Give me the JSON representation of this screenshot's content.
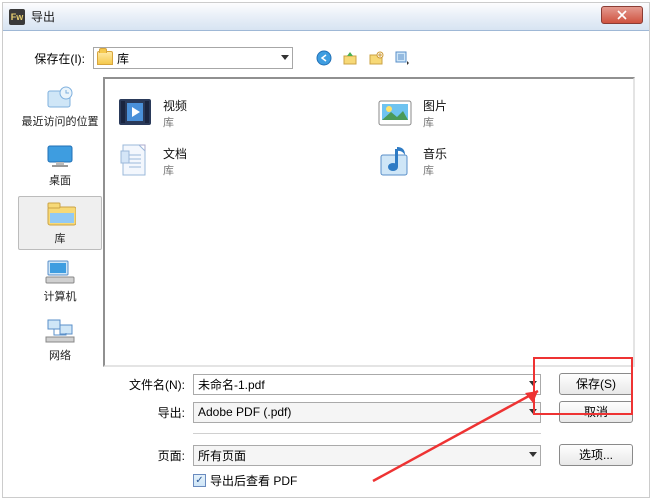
{
  "window": {
    "title": "导出"
  },
  "save_in": {
    "label": "保存在(I):",
    "value": "库"
  },
  "places": {
    "recent": "最近访问的位置",
    "desktop": "桌面",
    "library": "库",
    "computer": "计算机",
    "network": "网络"
  },
  "libraries": {
    "video": {
      "name": "视频",
      "type": "库"
    },
    "pictures": {
      "name": "图片",
      "type": "库"
    },
    "documents": {
      "name": "文档",
      "type": "库"
    },
    "music": {
      "name": "音乐",
      "type": "库"
    }
  },
  "filename": {
    "label": "文件名(N):",
    "value": "未命名-1.pdf"
  },
  "export": {
    "label": "导出:",
    "value": "Adobe PDF (.pdf)"
  },
  "pages": {
    "label": "页面:",
    "value": "所有页面"
  },
  "checkbox": {
    "label": "导出后查看 PDF"
  },
  "buttons": {
    "save": "保存(S)",
    "cancel": "取消",
    "options": "选项..."
  }
}
